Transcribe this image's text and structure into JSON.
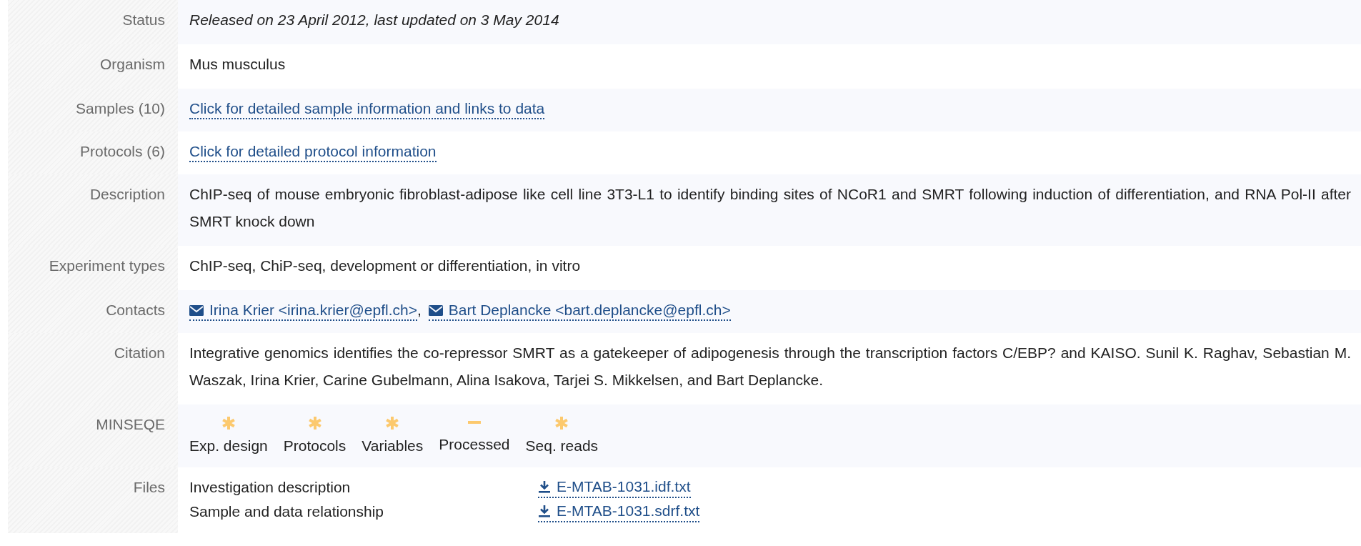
{
  "rows": [
    {
      "label": "Status",
      "kind": "italic",
      "text": "Released on 23 April 2012, last updated on 3 May 2014"
    },
    {
      "label": "Organism",
      "kind": "text",
      "text": "Mus musculus"
    },
    {
      "label": "Samples (10)",
      "kind": "link",
      "text": "Click for detailed sample information and links to data"
    },
    {
      "label": "Protocols (6)",
      "kind": "link",
      "text": "Click for detailed protocol information"
    },
    {
      "label": "Description",
      "kind": "text",
      "text": "ChIP-seq of mouse embryonic fibroblast-adipose like cell line 3T3-L1 to identify binding sites of NCoR1 and SMRT following induction of differentiation, and RNA Pol-II after SMRT knock down"
    },
    {
      "label": "Experiment types",
      "kind": "text",
      "text": "ChIP-seq, ChiP-seq, development or differentiation, in vitro"
    },
    {
      "label": "Contacts",
      "kind": "contacts",
      "separator": ",",
      "contacts": [
        "Irina Krier <irina.krier@epfl.ch>",
        "Bart Deplancke <bart.deplancke@epfl.ch>"
      ]
    },
    {
      "label": "Citation",
      "kind": "text",
      "text": "Integrative genomics identifies the co-repressor SMRT as a gatekeeper of adipogenesis through the transcription factors C/EBP? and KAISO. Sunil K. Raghav, Sebastian M. Waszak, Irina Krier, Carine Gubelmann, Alina Isakova, Tarjei S. Mikkelsen, and Bart Deplancke."
    },
    {
      "label": "MINSEQE",
      "kind": "minseqe",
      "items": [
        {
          "label": "Exp. design",
          "met": true
        },
        {
          "label": "Protocols",
          "met": true
        },
        {
          "label": "Variables",
          "met": true
        },
        {
          "label": "Processed",
          "met": false
        },
        {
          "label": "Seq. reads",
          "met": true
        }
      ]
    },
    {
      "label": "Files",
      "kind": "files",
      "files": [
        {
          "description": "Investigation description",
          "file": "E-MTAB-1031.idf.txt"
        },
        {
          "description": "Sample and data relationship",
          "file": "E-MTAB-1031.sdrf.txt"
        }
      ]
    }
  ]
}
